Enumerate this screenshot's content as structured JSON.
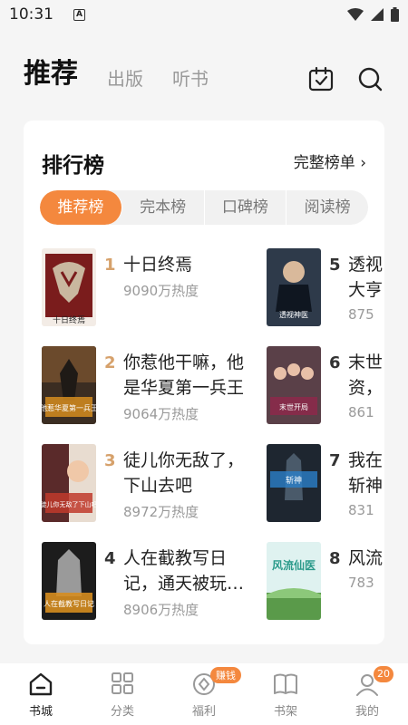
{
  "status": {
    "time": "10:31",
    "notif": "A"
  },
  "header": {
    "tabs": [
      "推荐",
      "出版",
      "听书"
    ]
  },
  "card": {
    "title": "排行榜",
    "more": "完整榜单 ›",
    "segments": [
      "推荐榜",
      "完本榜",
      "口碑榜",
      "阅读榜"
    ]
  },
  "books": [
    {
      "rank": "1",
      "title": "十日终焉",
      "heat": "9090万热度",
      "cover": "#7a1c1c"
    },
    {
      "rank": "2",
      "title": "你惹他干嘛，他是华夏第一兵王",
      "heat": "9064万热度",
      "cover": "#4b3a2a"
    },
    {
      "rank": "3",
      "title": "徒儿你无敌了，下山去吧",
      "heat": "8972万热度",
      "cover": "#6a2c2c"
    },
    {
      "rank": "4",
      "title": "人在截教写日记，通天被玩…",
      "heat": "8906万热度",
      "cover": "#2a2a2a"
    },
    {
      "rank": "5",
      "title": "透视\n大亨",
      "heat": "875",
      "cover": "#2e3a4a"
    },
    {
      "rank": "6",
      "title": "末世\n资，",
      "heat": "861",
      "cover": "#5a4048"
    },
    {
      "rank": "7",
      "title": "我在\n斩神",
      "heat": "831",
      "cover": "#1e2630"
    },
    {
      "rank": "8",
      "title": "风流",
      "heat": "783",
      "cover": "#3a7a4a"
    }
  ],
  "cover_text": {
    "b1": "十日终焉",
    "b2": "他惹华夏第一兵王",
    "b3": "徒儿你无敌了下山吧",
    "b4": "人在截教写日记",
    "b5": "透视神医",
    "b6": "末世开局",
    "b7": "斩神",
    "b8": "风流仙医"
  },
  "nav": {
    "items": [
      "书城",
      "分类",
      "福利",
      "书架",
      "我的"
    ],
    "earn_badge": "赚钱",
    "count_badge": "20"
  }
}
